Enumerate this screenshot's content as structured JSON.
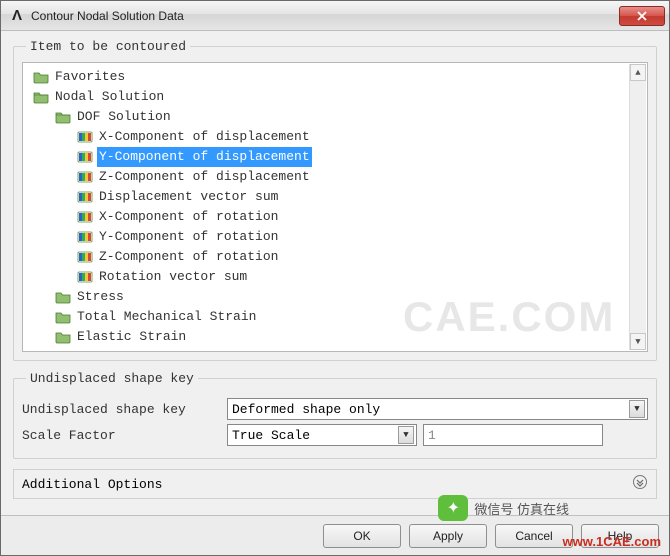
{
  "window": {
    "title": "Contour Nodal Solution Data"
  },
  "group1": {
    "legend": "Item to be contoured"
  },
  "tree": {
    "favorites": "Favorites",
    "nodal": "Nodal Solution",
    "dof": "DOF Solution",
    "items": [
      "X-Component of displacement",
      "Y-Component of displacement",
      "Z-Component of displacement",
      "Displacement vector sum",
      "X-Component of rotation",
      "Y-Component of rotation",
      "Z-Component of rotation",
      "Rotation vector sum"
    ],
    "stress": "Stress",
    "totstrain": "Total Mechanical Strain",
    "elstrain": "Elastic Strain",
    "selected_index": 1
  },
  "group2": {
    "legend": "Undisplaced shape key",
    "row1_label": "Undisplaced shape key",
    "row1_value": "Deformed shape only",
    "row2_label": "Scale Factor",
    "row2_value": "True Scale",
    "row2_num": "1"
  },
  "additional": "Additional Options",
  "buttons": {
    "ok": "OK",
    "apply": "Apply",
    "cancel": "Cancel",
    "help": "Help"
  },
  "watermarks": {
    "big": "CAE.COM",
    "url": "www.1CAE.com",
    "chat": "微信号 仿真在线"
  }
}
